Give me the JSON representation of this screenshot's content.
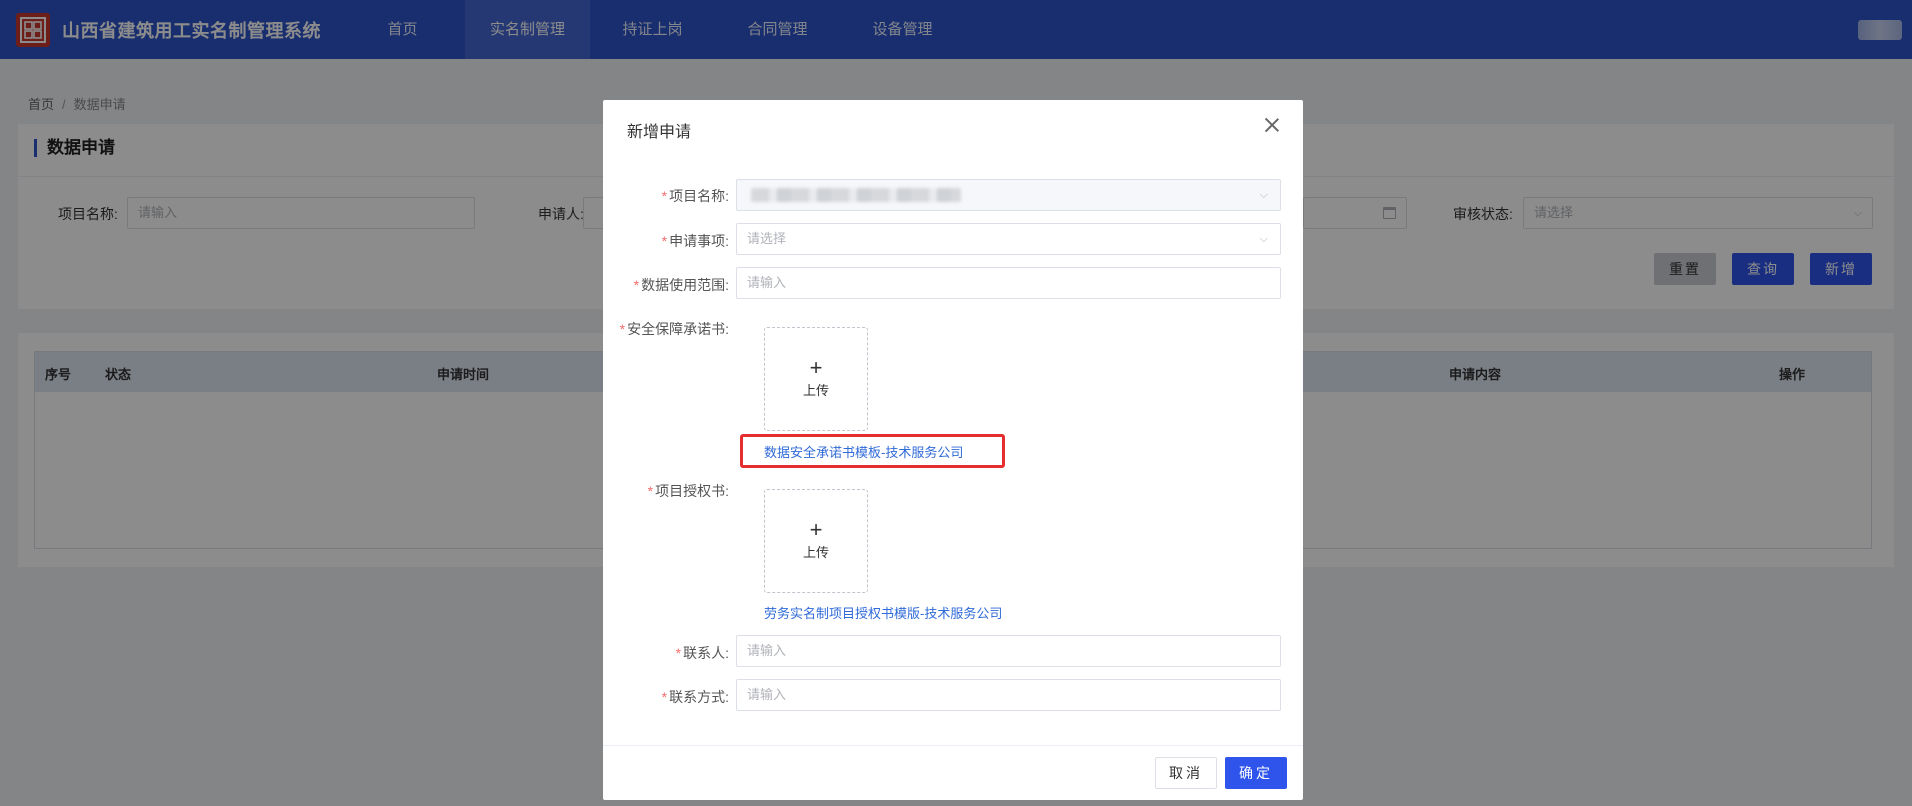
{
  "header": {
    "app_title": "山西省建筑用工实名制管理系统",
    "nav": [
      "首页",
      "实名制管理",
      "持证上岗",
      "合同管理",
      "设备管理"
    ],
    "active_nav": "实名制管理"
  },
  "breadcrumb": {
    "home": "首页",
    "separator": "/",
    "current": "数据申请"
  },
  "page": {
    "title": "数据申请",
    "filters": {
      "project_label": "项目名称:",
      "project_placeholder": "请输入",
      "applicant_label": "申请人:",
      "status_label": "审核状态:",
      "status_placeholder": "请选择"
    },
    "buttons": {
      "reset": "重置",
      "search": "查询",
      "add": "新增"
    },
    "table_headers": [
      "序号",
      "状态",
      "申请时间",
      "申请内容",
      "操作"
    ]
  },
  "dialog": {
    "title": "新增申请",
    "fields": {
      "project_label": "项目名称:",
      "item_label": "申请事项:",
      "item_placeholder": "请选择",
      "scope_label": "数据使用范围:",
      "scope_placeholder": "请输入",
      "security_label": "安全保障承诺书:",
      "upload_text": "上传",
      "security_template": "数据安全承诺书模板-技术服务公司",
      "auth_label": "项目授权书:",
      "auth_template": "劳务实名制项目授权书模版-技术服务公司",
      "contact_label": "联系人:",
      "contact_placeholder": "请输入",
      "phone_label": "联系方式:",
      "phone_placeholder": "请输入"
    },
    "required_mark": "*",
    "cancel": "取消",
    "confirm": "确定"
  },
  "colors": {
    "primary": "#2f54c9",
    "button": "#2f54eb",
    "required": "#f56c6c",
    "highlight": "#e62e2e",
    "link": "#2f6ad8"
  },
  "icons": {
    "logo": "logo-icon",
    "close": "close-icon",
    "dropdown": "chevron-down-icon",
    "calendar": "calendar-icon",
    "upload": "plus-icon"
  }
}
